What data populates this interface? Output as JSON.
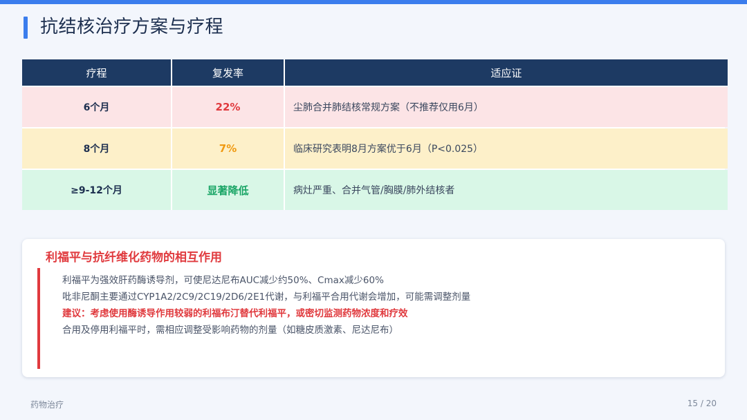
{
  "header": {
    "title": "抗结核治疗方案与疗程"
  },
  "table": {
    "headers": [
      "疗程",
      "复发率",
      "适应证"
    ],
    "rows": [
      {
        "duration": "6个月",
        "rate": "22%",
        "rate_color": "#e03a3e",
        "indication": "尘肺合并肺结核常规方案（不推荐仅用6月）"
      },
      {
        "duration": "8个月",
        "rate": "7%",
        "rate_color": "#f09a12",
        "indication": "临床研究表明8月方案优于6月（P<0.025）"
      },
      {
        "duration": "≥9-12个月",
        "rate": "显著降低",
        "rate_color": "#1aa566",
        "indication": "病灶严重、合并气管/胸膜/肺外结核者"
      }
    ]
  },
  "interaction_card": {
    "title": "利福平与抗纤维化药物的相互作用",
    "lines": [
      "利福平为强效肝药酶诱导剂，可使尼达尼布AUC减少约50%、Cmax减少60%",
      "吡非尼酮主要通过CYP1A2/2C9/2C19/2D6/2E1代谢，与利福平合用代谢会增加，可能需调整剂量",
      "建议：考虑使用酶诱导作用较弱的利福布汀替代利福平，或密切监测药物浓度和疗效",
      "合用及停用利福平时，需相应调整受影响药物的剂量（如糖皮质激素、尼达尼布）"
    ]
  },
  "footer": {
    "section": "药物治疗",
    "page": "15 / 20"
  },
  "colors": {
    "accent": "#3b7ded",
    "header_bg": "#1d3a63",
    "alert": "#e03a3e"
  }
}
